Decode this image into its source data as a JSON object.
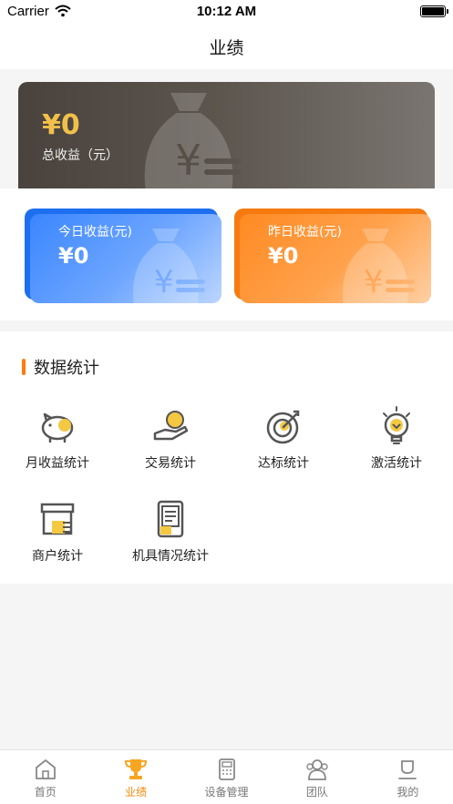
{
  "status_bar": {
    "carrier": "Carrier",
    "time": "10:12 AM"
  },
  "nav": {
    "title": "业绩"
  },
  "total": {
    "amount": "¥0",
    "label": "总收益（元）"
  },
  "today": {
    "label": "今日收益(元)",
    "amount": "¥0"
  },
  "yesterday": {
    "label": "昨日收益(元)",
    "amount": "¥0"
  },
  "stats": {
    "title": "数据统计",
    "items": [
      {
        "label": "月收益统计",
        "icon": "piggy-bank-icon"
      },
      {
        "label": "交易统计",
        "icon": "hand-coin-icon"
      },
      {
        "label": "达标统计",
        "icon": "target-icon"
      },
      {
        "label": "激活统计",
        "icon": "lightbulb-icon"
      },
      {
        "label": "商户统计",
        "icon": "store-icon"
      },
      {
        "label": "机具情况统计",
        "icon": "device-icon"
      }
    ]
  },
  "tabs": [
    {
      "label": "首页",
      "icon": "home-icon",
      "active": false
    },
    {
      "label": "业绩",
      "icon": "trophy-icon",
      "active": true
    },
    {
      "label": "设备管理",
      "icon": "calculator-icon",
      "active": false
    },
    {
      "label": "团队",
      "icon": "team-icon",
      "active": false
    },
    {
      "label": "我的",
      "icon": "profile-icon",
      "active": false
    }
  ],
  "colors": {
    "accent": "#ff7a0e",
    "active_tab": "#f08a10",
    "today_card": "#3a86ff",
    "yesterday_card": "#ff8a22",
    "total_card": "#4a433d",
    "total_amount": "#f2c04a"
  }
}
